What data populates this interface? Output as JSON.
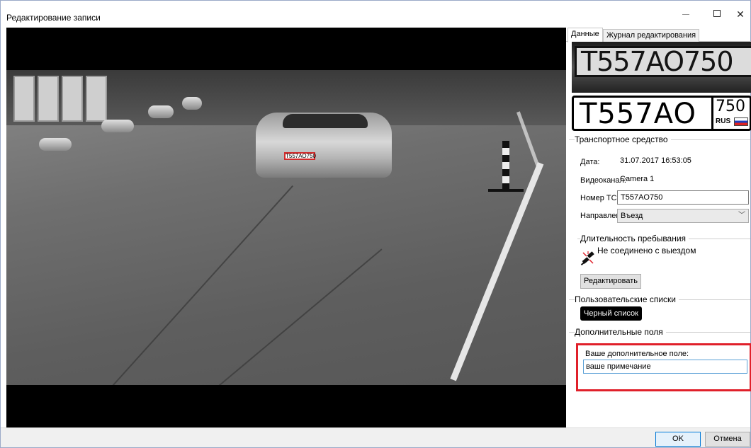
{
  "window": {
    "title": "Редактирование записи"
  },
  "video": {
    "overlay_plate": "T557АО750"
  },
  "tabs": [
    {
      "label": "Данные",
      "active": true
    },
    {
      "label": "Журнал редактирования",
      "active": false
    }
  ],
  "plate": {
    "photo_text": "T557AO750",
    "main": "T557AO",
    "region": "750",
    "country": "RUS"
  },
  "vehicle": {
    "group_title": "Транспортное средство",
    "date_label": "Дата:",
    "date_value": "31.07.2017 16:53:05",
    "channel_label": "Видеоканал:",
    "channel_value": "Camera 1",
    "number_label": "Номер ТС",
    "number_value": "T557AO750",
    "direction_label": "Направление:",
    "direction_value": "Въезд"
  },
  "stay": {
    "group_title": "Длительность пребывания",
    "status": "Не соединено с выездом",
    "edit_button": "Редактировать"
  },
  "user_lists": {
    "group_title": "Пользовательские списки",
    "badge": "Черный список"
  },
  "extra_fields": {
    "group_title": "Дополнительные поля",
    "field_label": "Ваше дополнительное поле:",
    "field_value": "ваше примечание"
  },
  "footer": {
    "ok_label": "OK",
    "cancel_label": "Отмена"
  },
  "colors": {
    "highlight_border": "#e0202a",
    "blacklist_badge": "#000000",
    "flag_white": "#ffffff",
    "flag_blue": "#1f3fbd",
    "flag_red": "#dd2222"
  },
  "icons": {
    "minimize": "minimize-icon",
    "maximize": "maximize-icon",
    "close": "close-icon",
    "unlinked": "unlinked-plug-icon",
    "dropdown": "chevron-down-icon"
  }
}
